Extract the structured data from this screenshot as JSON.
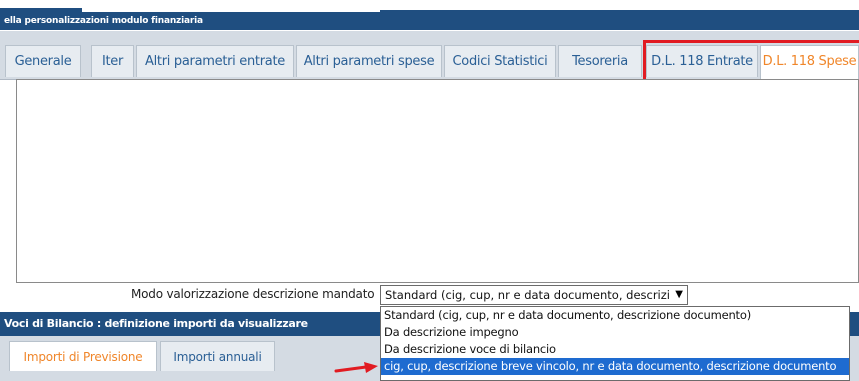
{
  "panel": {
    "title": "ella personalizzazioni modulo finanziaria"
  },
  "tabs": [
    {
      "label": "Generale"
    },
    {
      "label": "Iter"
    },
    {
      "label": "Altri parametri entrate"
    },
    {
      "label": "Altri parametri spese"
    },
    {
      "label": "Codici Statistici"
    },
    {
      "label": "Tesoreria"
    },
    {
      "label": "D.L. 118 Entrate"
    },
    {
      "label": "D.L. 118 Spese",
      "active": true
    }
  ],
  "form": {
    "mandate_description_label": "Modo valorizzazione descrizione mandato",
    "mandate_description_value": "Standard (cig, cup, nr e data documento, descrizione documento)",
    "options": [
      "Standard (cig, cup, nr e data documento, descrizione documento)",
      "Da descrizione impegno",
      "Da descrizione voce di bilancio",
      "cig, cup, descrizione breve vincolo, nr e data documento, descrizione documento"
    ],
    "highlighted_option_index": 3
  },
  "section": {
    "title": "Voci di Bilancio : definizione importi da visualizzare"
  },
  "bottom_tabs": [
    {
      "label": "Importi di Previsione",
      "active": true
    },
    {
      "label": "Importi annuali"
    }
  ],
  "colors": {
    "header_blue": "#1f4e80",
    "tab_text_blue": "#2a5f95",
    "active_tab_orange": "#f0862a",
    "highlight_red": "#e11b22",
    "selection_blue": "#1e6bd0"
  },
  "icons": {
    "select_chevron": "chevron-down-icon",
    "annotation_arrow": "red-arrow-icon"
  }
}
